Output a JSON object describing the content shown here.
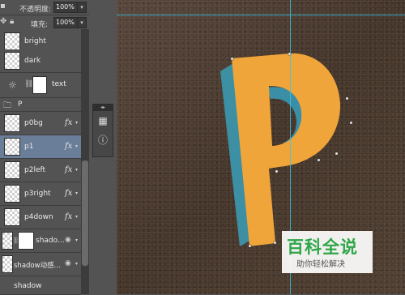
{
  "controls": {
    "opacity_label": "不透明度:",
    "opacity_value": "100%",
    "fill_label": "填充:",
    "fill_value": "100%"
  },
  "layers_top": [
    {
      "name": "bright"
    },
    {
      "name": "dark"
    },
    {
      "name": "text"
    }
  ],
  "group": {
    "name": "P"
  },
  "layers": [
    {
      "name": "p0bg",
      "fx": "fx"
    },
    {
      "name": "p1",
      "fx": "fx"
    },
    {
      "name": "p2left",
      "fx": "fx"
    },
    {
      "name": "p3right",
      "fx": "fx"
    },
    {
      "name": "p4down",
      "fx": "fx"
    }
  ],
  "layers_bottom": [
    {
      "name": "shado..."
    },
    {
      "name": "shadow动感..."
    },
    {
      "name": "shadow"
    }
  ],
  "canvas": {
    "letter": "P",
    "letter_color": "#f0a53a",
    "side_color": "#3a8fa6"
  },
  "watermark": {
    "title": "百科全说",
    "subtitle": "助你轻松解决"
  },
  "colors": {
    "guide": "#38c8e8",
    "selected_layer": "#6a7d99"
  }
}
